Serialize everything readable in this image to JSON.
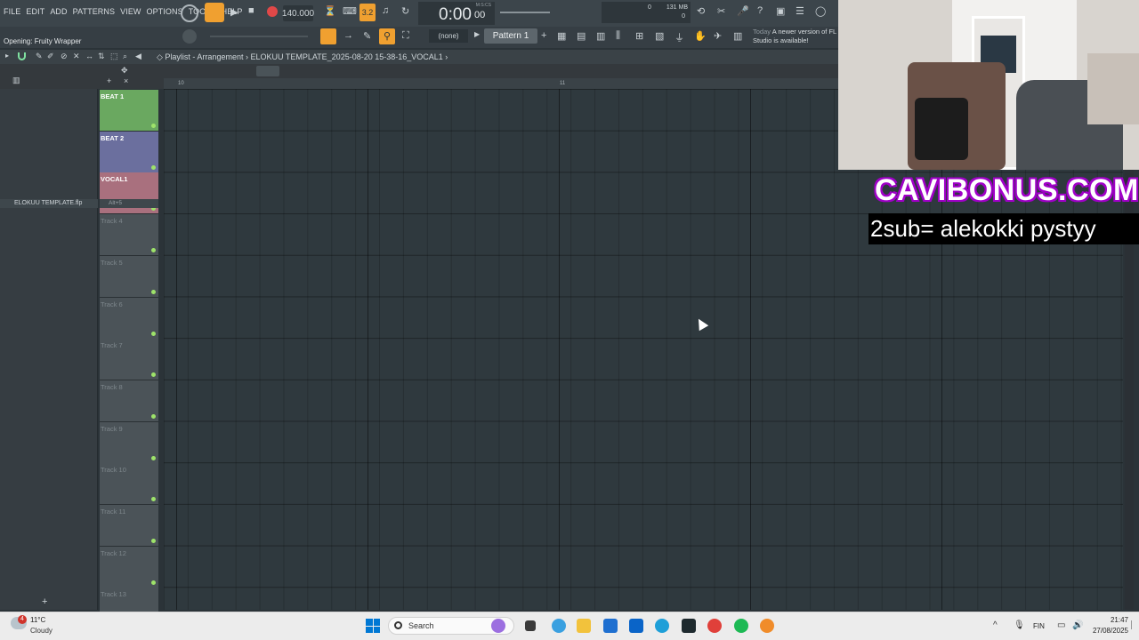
{
  "menu": [
    "FILE",
    "EDIT",
    "ADD",
    "PATTERNS",
    "VIEW",
    "OPTIONS",
    "TOOLS",
    "HELP"
  ],
  "transport": {
    "tempo": "140.000",
    "time": "0:00",
    "time_small": "00",
    "time_label": "M:S:CS",
    "mem": "131 MB",
    "cpu": "0",
    "poly": "0",
    "step": "3.2"
  },
  "hint_text": "Opening: Fruity Wrapper",
  "pattern": {
    "none_label": "(none)",
    "name": "Pattern 1"
  },
  "news": {
    "day": "Today",
    "msg": "A newer version of FL Studio is available!"
  },
  "playlist": {
    "title": "Playlist - Arrangement",
    "project": "ELOKUU TEMPLATE_2025-08-20 15-38-16_VOCAL1"
  },
  "ruler": {
    "bar_10": "10",
    "bar_11": "11"
  },
  "browser": {
    "item": "ELOKUU TEMPLATE.flp",
    "shortcut": "Alt+5"
  },
  "tracks": [
    {
      "label": "BEAT 1",
      "color": "#6aa860"
    },
    {
      "label": "BEAT 2",
      "color": "#6b6f9e"
    },
    {
      "label": "VOCAL1",
      "color": "#a9707e"
    },
    {
      "label": "Track 4",
      "color": "#4b5358"
    },
    {
      "label": "Track 5",
      "color": "#4b5358"
    },
    {
      "label": "Track 6",
      "color": "#4b5358"
    },
    {
      "label": "Track 7",
      "color": "#4b5358"
    },
    {
      "label": "Track 8",
      "color": "#4b5358"
    },
    {
      "label": "Track 9",
      "color": "#4b5358"
    },
    {
      "label": "Track 10",
      "color": "#4b5358"
    },
    {
      "label": "Track 11",
      "color": "#4b5358"
    },
    {
      "label": "Track 12",
      "color": "#4b5358"
    },
    {
      "label": "Track 13",
      "color": "#4b5358"
    }
  ],
  "overlay": {
    "brand": "CAVIBONUS.COM",
    "sub_text": "2sub= alekokki pystyy"
  },
  "taskbar": {
    "weather_badge": "4",
    "temp": "11°C",
    "condition": "Cloudy",
    "search": "Search",
    "lang": "FIN",
    "time": "21:47",
    "date": "27/08/2025"
  }
}
